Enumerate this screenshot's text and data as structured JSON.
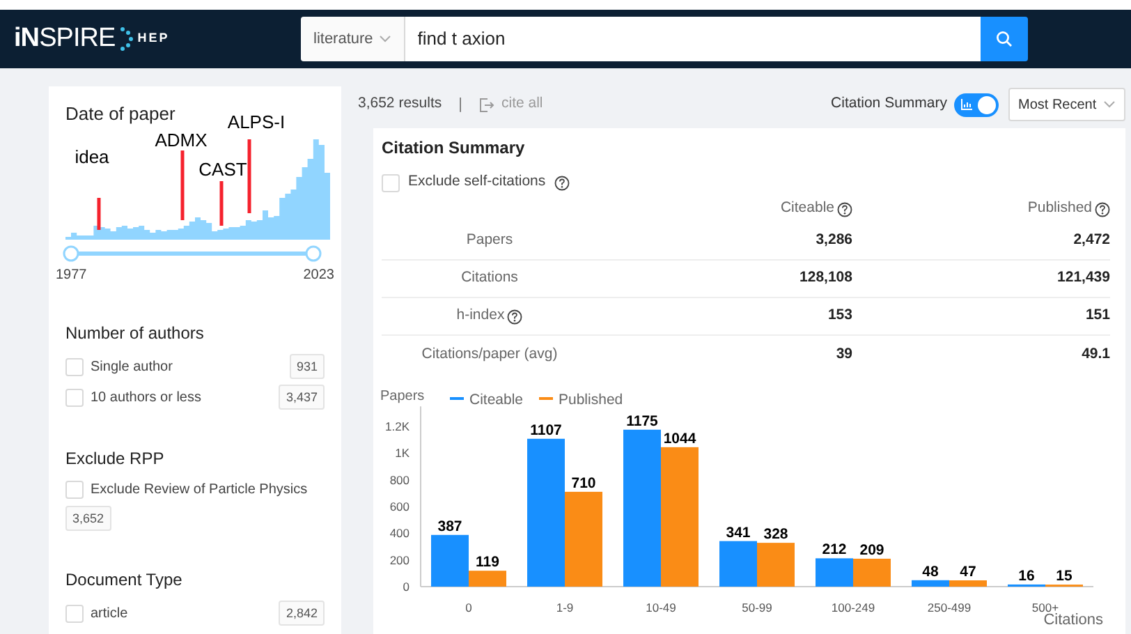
{
  "header": {
    "logo": "**iN**SPIRE",
    "logo_sub": "HEP",
    "search": {
      "scope": "literature",
      "value": "find t axion"
    }
  },
  "sidebar": {
    "date_facet": {
      "title": "Date of paper",
      "annotations": [
        "idea",
        "ADMX",
        "CAST",
        "ALPS-I"
      ],
      "range_start": "1977",
      "range_end": "2023",
      "handles": [
        {
          "level": 0
        },
        {
          "level": 1
        }
      ]
    },
    "facets": [
      {
        "title": "Number of authors",
        "options": [
          {
            "label": "Single author",
            "count": "931",
            "checked": false
          },
          {
            "label": "10 authors or less",
            "count": "3,437",
            "checked": false
          }
        ]
      },
      {
        "title": "Exclude RPP",
        "options": [
          {
            "label": "Exclude Review of Particle Physics",
            "count": "3,652",
            "checked": false
          }
        ]
      },
      {
        "title": "Document Type",
        "options": [
          {
            "label": "article",
            "count": "2,842",
            "checked": false
          }
        ]
      }
    ]
  },
  "results": {
    "count": "3,652 results",
    "separator": "|",
    "cite_all": {
      "label": "cite all",
      "disabled": true
    },
    "citation_summary_toggle": {
      "label": "Citation Summary",
      "on": true
    },
    "sort": "Most Recent"
  },
  "citation_summary": {
    "title": "Citation Summary",
    "exclude_self": {
      "label": "Exclude self-citations",
      "checked": false
    },
    "columns": [
      "Citeable",
      "Published"
    ],
    "rows": [
      {
        "label": "Papers",
        "help": false,
        "citeable": "3,286",
        "published": "2,472"
      },
      {
        "label": "Citations",
        "help": false,
        "citeable": "128,108",
        "published": "121,439"
      },
      {
        "label": "h-index",
        "help": true,
        "citeable": "153",
        "published": "151"
      },
      {
        "label": "Citations/paper (avg)",
        "help": false,
        "citeable": "39",
        "published": "49.1"
      }
    ],
    "chart_data": {
      "type": "bar",
      "ylabel": "Papers",
      "xlabel": "Citations",
      "categories": [
        "0",
        "1-9",
        "10-49",
        "50-99",
        "100-249",
        "250-499",
        "500+"
      ],
      "series": [
        {
          "name": "Citeable",
          "color": "#1890ff",
          "values": [
            387,
            1107,
            1175,
            341,
            212,
            48,
            16
          ]
        },
        {
          "name": "Published",
          "color": "#fa8c16",
          "values": [
            119,
            710,
            1044,
            328,
            209,
            47,
            15
          ]
        }
      ],
      "ylim": [
        0,
        1350
      ],
      "yticks": [
        0,
        200,
        400,
        600,
        800,
        {
          "value": 1000,
          "label": "1K"
        },
        {
          "value": 1200,
          "label": "1.2K"
        }
      ],
      "data_labels": true,
      "legend": "top"
    }
  }
}
